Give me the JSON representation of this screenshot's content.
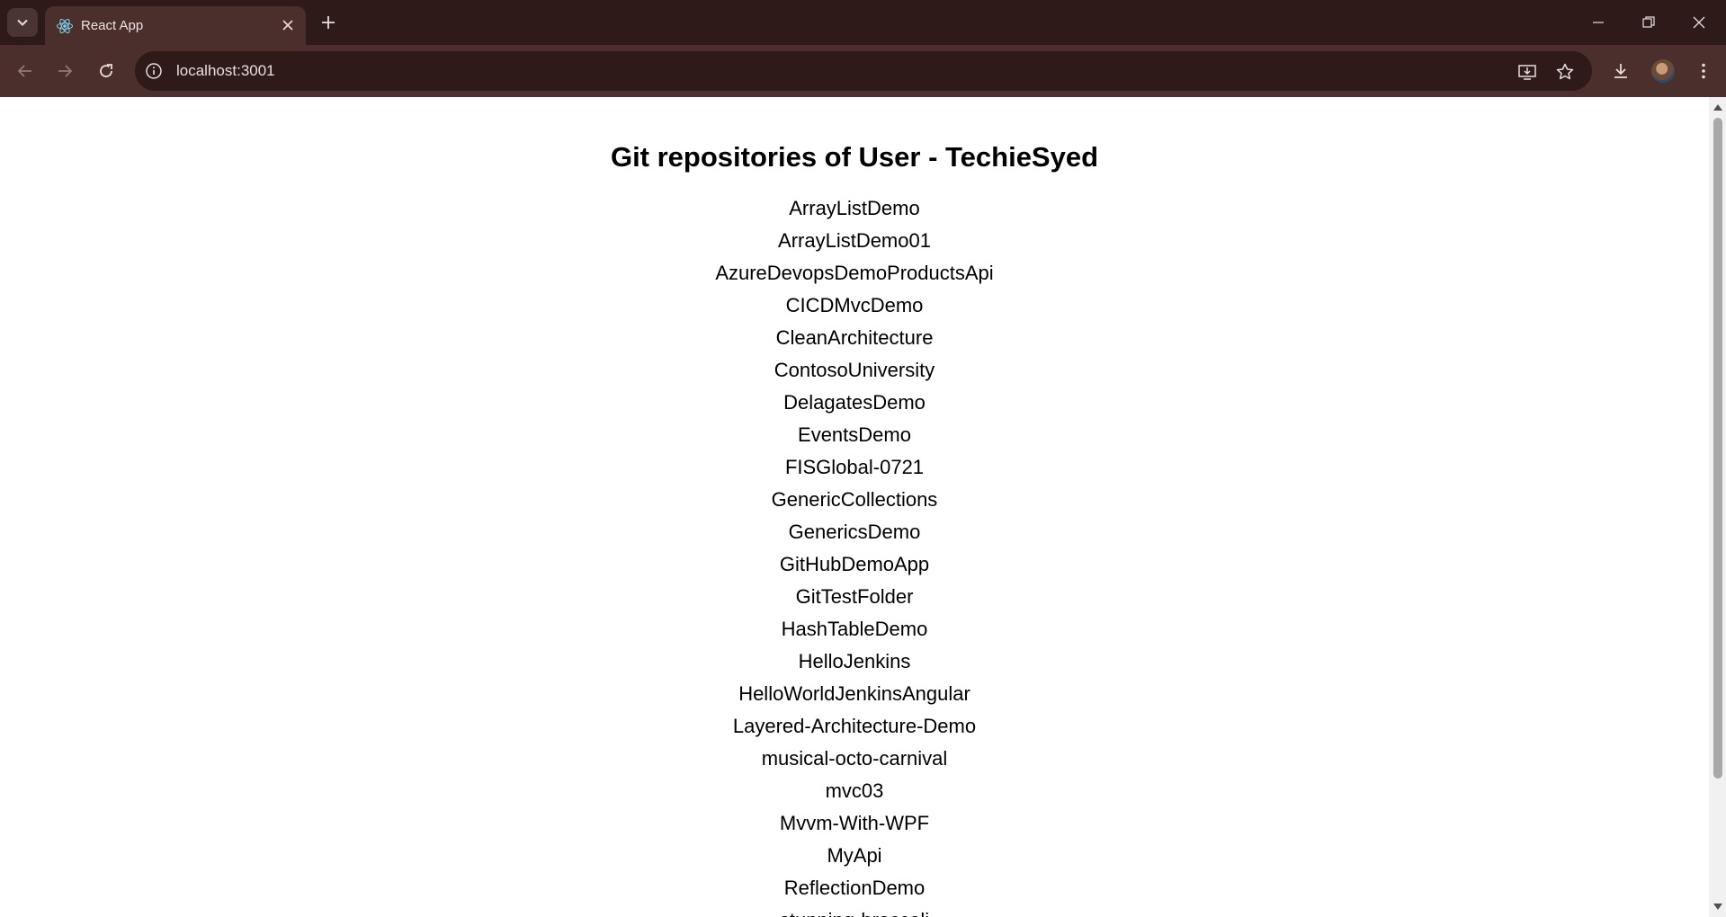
{
  "browser": {
    "tab_title": "React App",
    "url": "localhost:3001"
  },
  "page": {
    "heading": "Git repositories of User - TechieSyed",
    "repositories": [
      "ArrayListDemo",
      "ArrayListDemo01",
      "AzureDevopsDemoProductsApi",
      "CICDMvcDemo",
      "CleanArchitecture",
      "ContosoUniversity",
      "DelagatesDemo",
      "EventsDemo",
      "FISGlobal-0721",
      "GenericCollections",
      "GenericsDemo",
      "GitHubDemoApp",
      "GitTestFolder",
      "HashTableDemo",
      "HelloJenkins",
      "HelloWorldJenkinsAngular",
      "Layered-Architecture-Demo",
      "musical-octo-carnival",
      "mvc03",
      "Mvvm-With-WPF",
      "MyApi",
      "ReflectionDemo",
      "stunning-broccoli"
    ]
  },
  "icons": {
    "tab_search": "chevron-down-icon",
    "favicon": "react-logo-icon",
    "tab_close": "close-icon",
    "new_tab": "plus-icon",
    "back": "arrow-left-icon",
    "forward": "arrow-right-icon",
    "reload": "reload-icon",
    "site_info": "info-icon",
    "install": "install-app-icon",
    "bookmark": "star-icon",
    "downloads": "download-icon",
    "menu": "kebab-menu-icon"
  },
  "colors": {
    "tab_strip": "#2d1a19",
    "toolbar": "#4b2f2d",
    "page_background": "#ffffff"
  }
}
